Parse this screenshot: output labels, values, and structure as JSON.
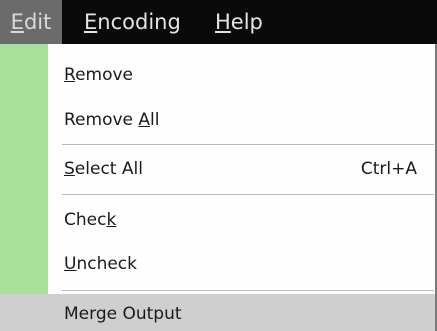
{
  "menubar": {
    "items": [
      {
        "label_pre": "",
        "mnemonic": "E",
        "label_post": "dit"
      },
      {
        "label_pre": "",
        "mnemonic": "E",
        "label_post": "ncoding"
      },
      {
        "label_pre": "",
        "mnemonic": "H",
        "label_post": "elp"
      }
    ]
  },
  "menu": {
    "remove": {
      "pre": "",
      "mn": "R",
      "post": "emove"
    },
    "remove_all": {
      "pre": "Remove ",
      "mn": "A",
      "post": "ll"
    },
    "select_all": {
      "pre": "",
      "mn": "S",
      "post": "elect All",
      "shortcut": "Ctrl+A"
    },
    "check": {
      "pre": "Chec",
      "mn": "k",
      "post": ""
    },
    "uncheck": {
      "pre": "",
      "mn": "U",
      "post": "ncheck"
    },
    "merge_output": {
      "label": "Merge Output"
    }
  },
  "colors": {
    "menubar_bg": "#0a0a0a",
    "active_menu_bg": "#6b6b6b",
    "gutter": "#a8e09a",
    "highlight_bg": "#cfcfcf"
  }
}
